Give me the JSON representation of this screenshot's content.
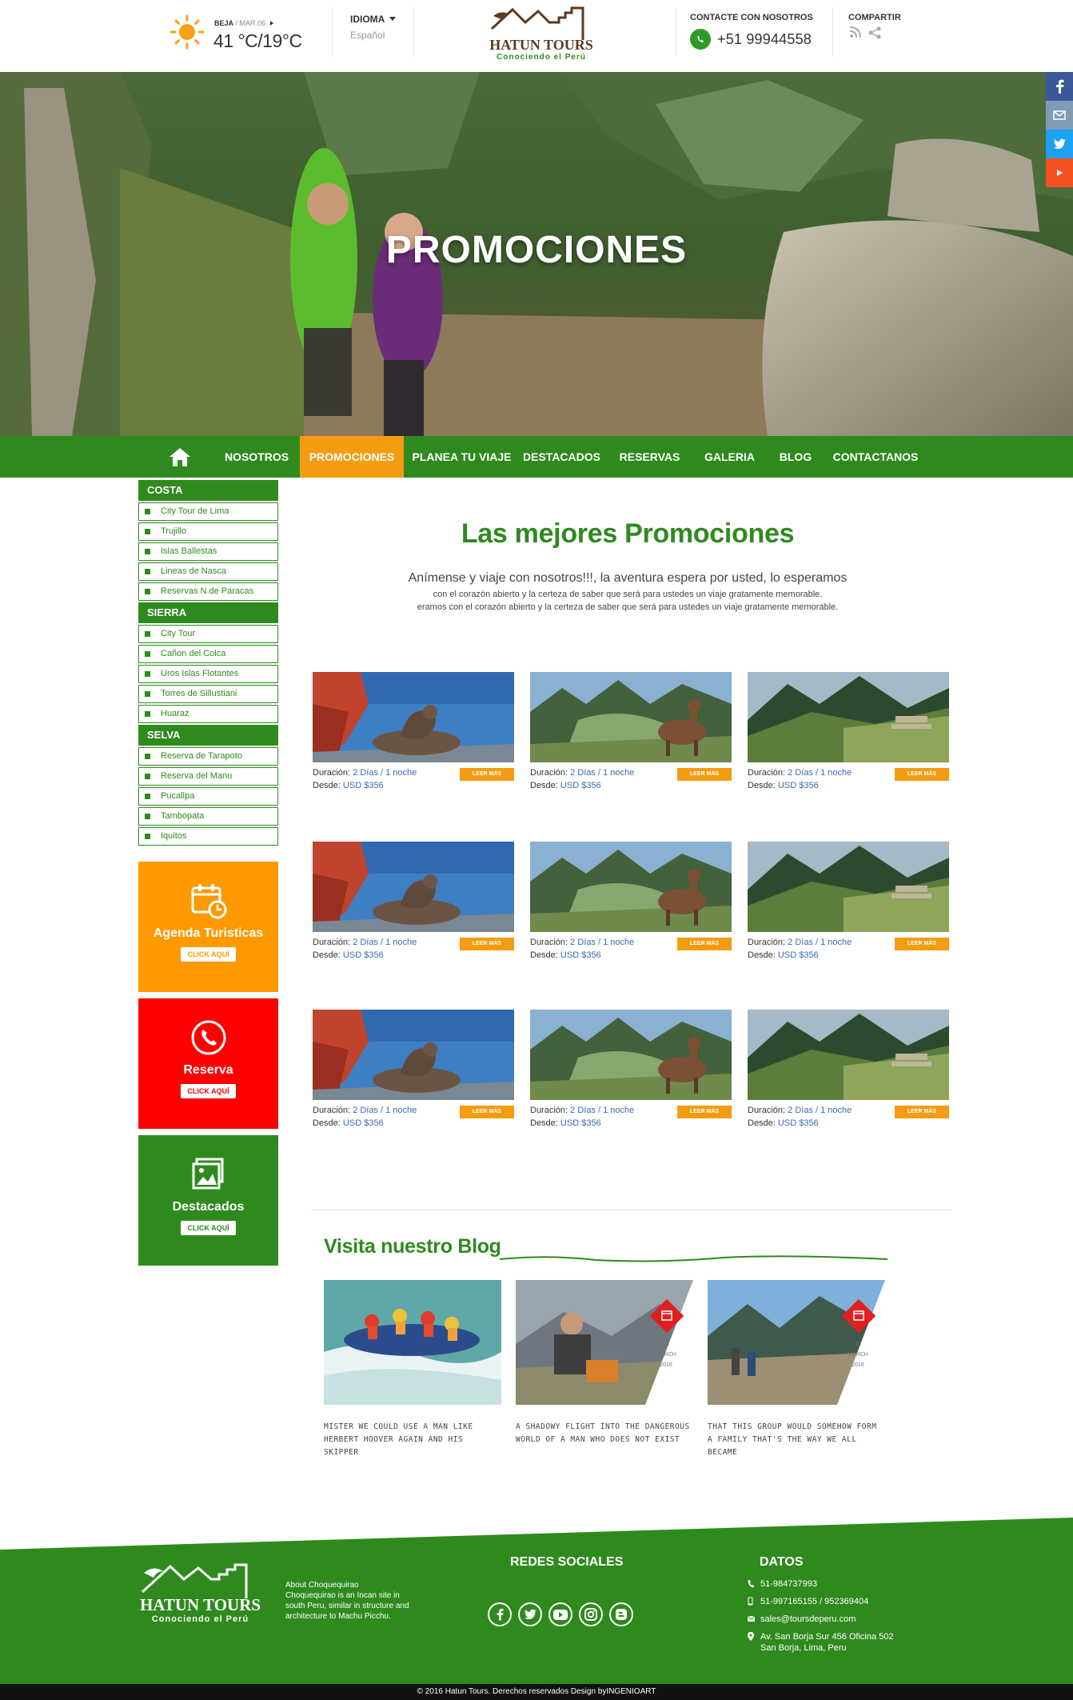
{
  "header": {
    "weather_location": "BEJA",
    "weather_date": "/ MAR.06",
    "weather_temp": "41 °C/19°C",
    "language_label": "IDIOMA",
    "language_value": "Español",
    "contact_label": "CONTACTE CON NOSOTROS",
    "contact_phone": "+51 99944558",
    "share_label": "COMPARTIR"
  },
  "logo": {
    "name": "HATUN TOURS",
    "tagline": "Conociendo el Perú"
  },
  "hero": {
    "title": "PROMOCIONES"
  },
  "social_side": [
    "facebook",
    "email",
    "twitter",
    "youtube"
  ],
  "nav": {
    "home_icon": "home-icon",
    "items": [
      "NOSOTROS",
      "PROMOCIONES",
      "PLANEA TU VIAJE",
      "DESTACADOS",
      "RESERVAS",
      "GALERIA",
      "BLOG",
      "CONTACTANOS"
    ],
    "active": "PROMOCIONES"
  },
  "sidebar": {
    "categories": [
      {
        "title": "COSTA",
        "items": [
          "City Tour de Lima",
          "Trujillo",
          "Islas Ballestas",
          "Lineas de Nasca",
          "Reservas N.de Paracas"
        ]
      },
      {
        "title": "SIERRA",
        "items": [
          "City Tour",
          "Cañon del Colca",
          "Uros Islas Flotantes",
          "Torres de Sillustiani",
          "Huaraz"
        ]
      },
      {
        "title": "SELVA",
        "items": [
          "Reserva de Tarapoto",
          "Reserva del Manu",
          "Pucallpa",
          "Tambopata",
          "Iquitos"
        ]
      }
    ],
    "boxes": [
      {
        "title": "Agenda Turisticas",
        "button": "CLICK AQUÍ",
        "color": "#FF9900",
        "icon": "calendar-icon"
      },
      {
        "title": "Reserva",
        "button": "CLICK AQUÍ",
        "color": "#FF0000",
        "icon": "phone-icon"
      },
      {
        "title": "Destacados",
        "button": "CLICK AQUÍ",
        "color": "#2F8A1E",
        "icon": "gallery-icon"
      }
    ]
  },
  "main": {
    "title": "Las mejores Promociones",
    "lead": "Anímense y viaje con nosotros!!!, la aventura espera por usted, lo esperamos",
    "sub1": "con el corazón abierto y la certeza de saber que será para ustedes un viaje gratamente memorable.",
    "sub2": "eramos con el corazón abierto y la certeza de saber que será para ustedes un viaje gratamente memorable."
  },
  "cards": {
    "duration_label": "Duración:",
    "duration_value": "2 Días / 1 noche",
    "price_label": "Desde:",
    "price_value": "USD $356",
    "button_label": "LEER MÁS",
    "images": [
      "sea-lion-photo",
      "machu-picchu-llama-photo",
      "mountain-valley-photo",
      "sea-lion-photo",
      "machu-picchu-llama-photo",
      "mountain-valley-photo",
      "sea-lion-photo",
      "machu-picchu-llama-photo",
      "mountain-valley-photo"
    ]
  },
  "blog": {
    "title": "Visita nuestro Blog",
    "posts": [
      {
        "text": "MISTER WE COULD USE A MAN LIKE HERBERT HOOVER AGAIN AND HIS SKIPPER",
        "image": "rafting-photo"
      },
      {
        "text": "A SHADOWY FLIGHT INTO THE DANGEROUS WORLD OF A MAN WHO DOES NOT EXIST",
        "image": "hiker-camp-photo",
        "day": "10",
        "month": "MARCH",
        "year": "2016"
      },
      {
        "text": "THAT THIS GROUP WOULD SOMEHOW FORM A FAMILY THAT'S THE WAY WE ALL BECAME",
        "image": "trekkers-photo",
        "day": "10",
        "month": "MARCH",
        "year": "2016"
      }
    ]
  },
  "footer": {
    "about_title": "About Choquequirao",
    "about_text": "Choquequirao is an Incan site in south Peru, similar in structure and architecture to Machu Picchu.",
    "social_title": "REDES SOCIALES",
    "social": [
      "facebook",
      "twitter",
      "youtube",
      "instagram",
      "blogger"
    ],
    "data_title": "DATOS",
    "phone1": "51-984737993",
    "phone2": "51-997165155 / 952369404",
    "email": "sales@toursdeperu.com",
    "address1": "Av. San Borja Sur 456 Oficina 502",
    "address2": "San Borja, Lima, Peru",
    "copyright": "© 2016  Hatun Tours. Derechos reservados Design byINGENIOART"
  },
  "colors": {
    "green": "#2F8A1E",
    "orange": "#F39C12",
    "red": "#FF0000"
  }
}
